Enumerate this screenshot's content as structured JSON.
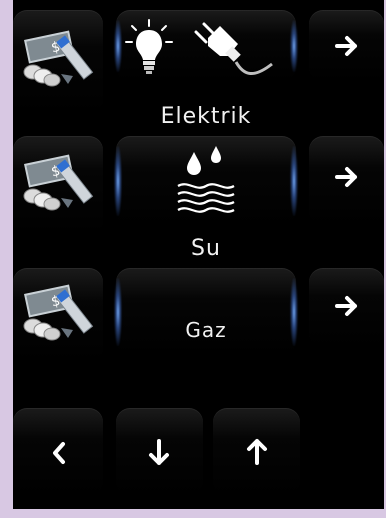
{
  "utilities": [
    {
      "label": "Elektrik",
      "icons": [
        "lightbulb-icon",
        "power-plug-icon"
      ]
    },
    {
      "label": "Su",
      "icons": [
        "water-drops-icon"
      ]
    },
    {
      "label": "Gaz",
      "icons": []
    }
  ],
  "nav": {
    "back_icon": "chevron-left-icon",
    "down_icon": "arrow-down-icon",
    "up_icon": "arrow-up-icon"
  },
  "colors": {
    "background": "#000000",
    "glow": "#78afff",
    "text": "#f2f2f2",
    "frame": "#d8c8e3"
  }
}
